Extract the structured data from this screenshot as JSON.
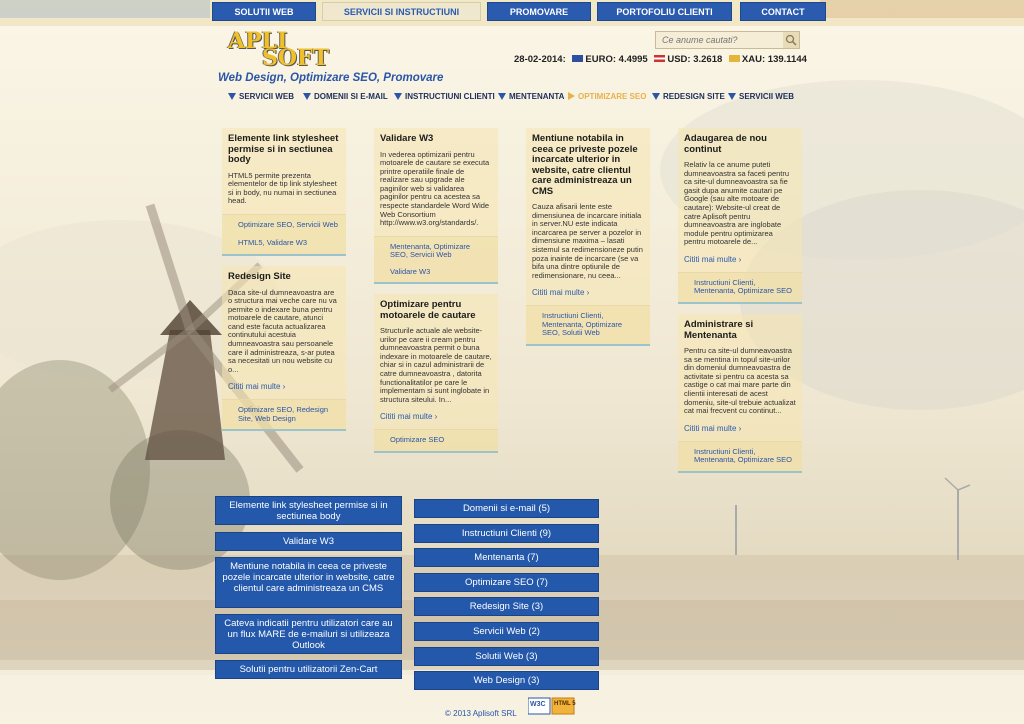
{
  "top_nav": [
    {
      "label": "SOLUTII WEB",
      "active": false
    },
    {
      "label": "SERVICII SI INSTRUCTIUNI",
      "active": true
    },
    {
      "label": "PROMOVARE",
      "active": false
    },
    {
      "label": "PORTOFOLIU CLIENTI",
      "active": false
    },
    {
      "label": "CONTACT",
      "active": false
    }
  ],
  "logo": {
    "line1": "APLI",
    "line2": "SOFT",
    "tagline": "Web Design, Optimizare SEO, Promovare"
  },
  "search": {
    "placeholder": "Ce anume cautati?"
  },
  "rates": {
    "date": "28-02-2014:",
    "euro": "EURO: 4.4995",
    "usd": "USD: 3.2618",
    "xau": "XAU: 139.1144"
  },
  "sub_nav": [
    {
      "label": "SERVICII WEB",
      "active": false
    },
    {
      "label": "DOMENII SI E-MAIL",
      "active": false
    },
    {
      "label": "INSTRUCTIUNI CLIENTI",
      "active": false
    },
    {
      "label": "MENTENANTA",
      "active": false
    },
    {
      "label": "OPTIMIZARE SEO",
      "active": true
    },
    {
      "label": "REDESIGN SITE",
      "active": false
    },
    {
      "label": "SERVICII WEB",
      "active": false
    }
  ],
  "cards": [
    {
      "title": "Elemente link stylesheet permise si in sectiunea body",
      "excerpt": "HTML5 permite prezenta elementelor de tip link stylesheet si in body, nu numai in sectiunea head.",
      "more": "",
      "tags": "Optimizare SEO, Servicii Web",
      "tags2": "HTML5, Validare W3"
    },
    {
      "title": "Redesign Site",
      "excerpt": "Daca site-ul dumneavoastra are o structura mai veche care nu va permite o indexare buna pentru motoarele de cautare, atunci cand este facuta actualizarea continutului acestuia dumneavoastra sau persoanele care il administreaza, s-ar putea sa necesitati un nou website cu o...",
      "more": "Cititi mai multe ›",
      "tags": "Optimizare SEO, Redesign Site, Web Design",
      "tags2": ""
    },
    {
      "title": "Validare W3",
      "excerpt": "In vederea optimizarii pentru motoarele de cautare se executa printre operatiile finale de realizare sau upgrade ale paginilor web si validarea paginilor pentru ca acestea sa respecte standardele Word Wide Web Consortium http://www.w3.org/standards/.",
      "more": "",
      "tags": "Mentenanta, Optimizare SEO, Servicii Web",
      "tags2": "Validare W3"
    },
    {
      "title": "Optimizare pentru motoarele de cautare",
      "excerpt": "Structurile actuale ale website-urilor pe care ii cream pentru dumneavoastra permit o buna indexare in motoarele de cautare, chiar si in cazul administrarii de catre dumneavoastra , datorita functionalitatilor pe care le implementam si sunt inglobate in structura siteului. In...",
      "more": "Cititi mai multe ›",
      "tags": "Optimizare SEO",
      "tags2": ""
    },
    {
      "title": "Mentiune notabila in ceea ce priveste pozele incarcate ulterior in website, catre clientul care administreaza un CMS",
      "excerpt": "Cauza afisarii lente este dimensiunea de incarcare initiala in server.NU este indicata incarcarea pe server a pozelor in dimensiune maxima – lasati sistemul sa redimensioneze putin poza inainte de incarcare (se va bifa una dintre optiunile de redimensionare, nu ceea...",
      "more": "Cititi mai multe ›",
      "tags": "Instructiuni Clienti, Mentenanta, Optimizare SEO, Solutii Web",
      "tags2": ""
    },
    {
      "title": "Adaugarea de nou continut",
      "excerpt": "Relativ la ce anume puteti dumneavoastra sa faceti pentru ca site-ul dumneavoastra sa fie gasit dupa anumite cautari pe Google (sau alte motoare de cautare): Website-ul creat de catre Aplisoft pentru dumneavoastra are inglobate module pentru optimizarea pentru motoarele de...",
      "more": "Cititi mai multe ›",
      "tags": "Instructiuni Clienti, Mentenanta, Optimizare SEO",
      "tags2": ""
    },
    {
      "title": "Administrare si Mentenanta",
      "excerpt": "Pentru ca site-ul dumneavoastra sa se mentina in topul site-urilor din domeniul dumneavoastra de activitate si pentru ca acesta sa castige o cat mai mare parte din clientii interesati de acest domeniu, site-ul trebuie actualizat cat mai frecvent cu continut...",
      "more": "Cititi mai multe ›",
      "tags": "Instructiuni Clienti, Mentenanta, Optimizare SEO",
      "tags2": ""
    }
  ],
  "recent_posts": [
    "Elemente link stylesheet permise si in sectiunea body",
    "Validare W3",
    "Mentiune notabila in ceea ce priveste pozele incarcate ulterior in website, catre clientul care administreaza un CMS",
    "Cateva indicatii pentru utilizatori care au un flux MARE de e-mailuri si utilizeaza Outlook",
    "Solutii pentru utilizatorii Zen-Cart"
  ],
  "categories": [
    "Domenii si e-mail  (5)",
    "Instructiuni Clienti  (9)",
    "Mentenanta  (7)",
    "Optimizare SEO  (7)",
    "Redesign Site  (3)",
    "Servicii Web  (2)",
    "Solutii Web  (3)",
    "Web Design  (3)"
  ],
  "footer": {
    "copyright": "© 2013 Aplisoft SRL",
    "badge_w3c": "W3C",
    "badge_html": "HTML 5"
  },
  "colors": {
    "accent": "#2358ab",
    "active_nav": "#e6b24a",
    "background": "#f3ead1"
  }
}
